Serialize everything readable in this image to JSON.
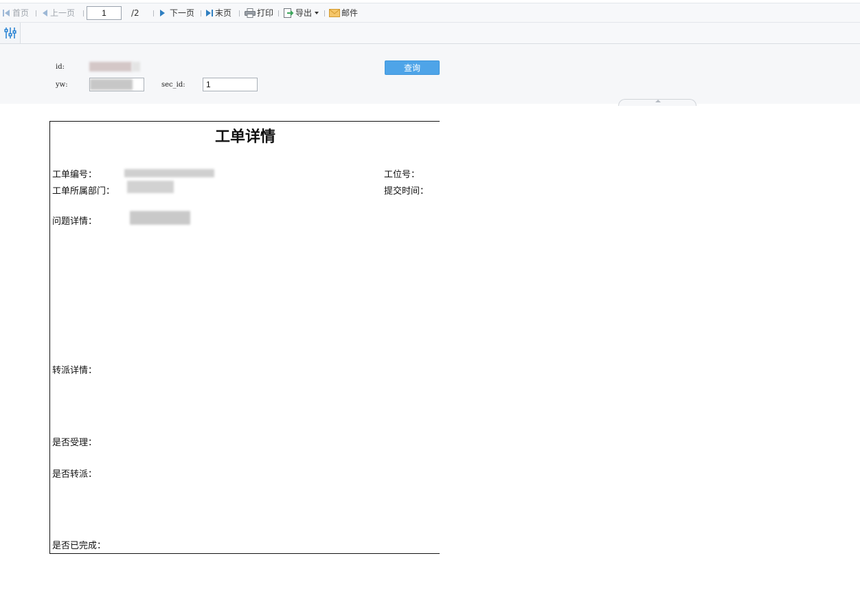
{
  "toolbar": {
    "first_page": "首页",
    "prev_page": "上一页",
    "current_page": "1",
    "total_pages": "/2",
    "next_page": "下一页",
    "last_page": "末页",
    "print": "打印",
    "export": "导出",
    "mail": "邮件"
  },
  "params": {
    "id_label": "id:",
    "yw_label": "yw:",
    "sec_id_label": "sec_id:",
    "sec_id_value": "1",
    "query_button": "查询"
  },
  "report": {
    "title": "工单详情",
    "order_no_label": "工单编号：",
    "seat_no_label": "工位号：",
    "department_label": "工单所属部门：",
    "submit_time_label": "提交时间：",
    "problem_detail_label": "问题详情：",
    "transfer_detail_label": "转派详情：",
    "accepted_label": "是否受理：",
    "transferred_label": "是否转派：",
    "completed_label": "是否已完成："
  },
  "colors": {
    "accent": "#4ea4e8",
    "nav_icon_active": "#2f7fc1",
    "nav_icon_disabled": "#9db8d6",
    "export_icon": "#3aa55a",
    "mail_icon": "#e0a53a"
  }
}
